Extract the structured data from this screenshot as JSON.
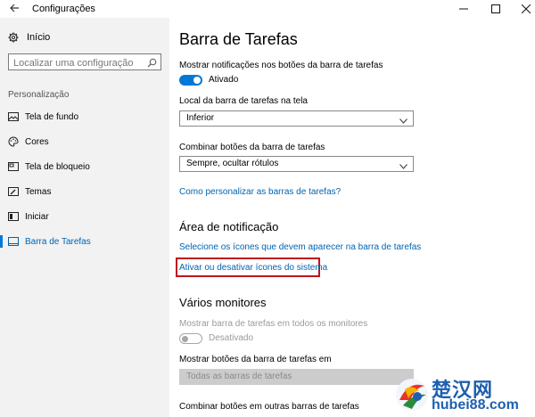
{
  "window": {
    "title": "Configurações",
    "back_icon": "back-arrow-icon",
    "controls": {
      "minimize": "—",
      "maximize": "☐",
      "close": "✕"
    }
  },
  "sidebar": {
    "home_label": "Início",
    "search": {
      "placeholder": "Localizar uma configuração",
      "value": ""
    },
    "section_heading": "Personalização",
    "items": [
      {
        "label": "Tela de fundo",
        "icon": "picture-icon"
      },
      {
        "label": "Cores",
        "icon": "palette-icon"
      },
      {
        "label": "Tela de bloqueio",
        "icon": "lock-screen-icon"
      },
      {
        "label": "Temas",
        "icon": "brush-icon"
      },
      {
        "label": "Iniciar",
        "icon": "start-icon"
      },
      {
        "label": "Barra de Tarefas",
        "icon": "taskbar-icon",
        "active": true
      }
    ],
    "accent_color": "#0078d7"
  },
  "main": {
    "title": "Barra de Tarefas",
    "notifications": {
      "label": "Mostrar notificações nos botões da barra de tarefas",
      "state": "Ativado",
      "on": true
    },
    "location": {
      "label": "Local da barra de tarefas na tela",
      "value": "Inferior"
    },
    "combine": {
      "label": "Combinar botões da barra de tarefas",
      "value": "Sempre, ocultar rótulos"
    },
    "customize_link": "Como personalizar as barras de tarefas?",
    "notification_area": {
      "heading": "Área de notificação",
      "select_icons_link": "Selecione os ícones que devem aparecer na barra de tarefas",
      "system_icons_link": "Ativar ou desativar ícones do sistema"
    },
    "monitors": {
      "heading": "Vários monitores",
      "show_all": {
        "label": "Mostrar barra de tarefas em todos os monitores",
        "state": "Desativado",
        "on": false
      },
      "show_buttons": {
        "label": "Mostrar botões da barra de tarefas em",
        "value": "Todas as barras de tarefas"
      },
      "combine_other": {
        "label": "Combinar botões em outras barras de tarefas"
      }
    },
    "highlight_color": "#c0141c"
  },
  "watermark": {
    "chinese": "楚汉网",
    "url": "hubei88.com"
  }
}
